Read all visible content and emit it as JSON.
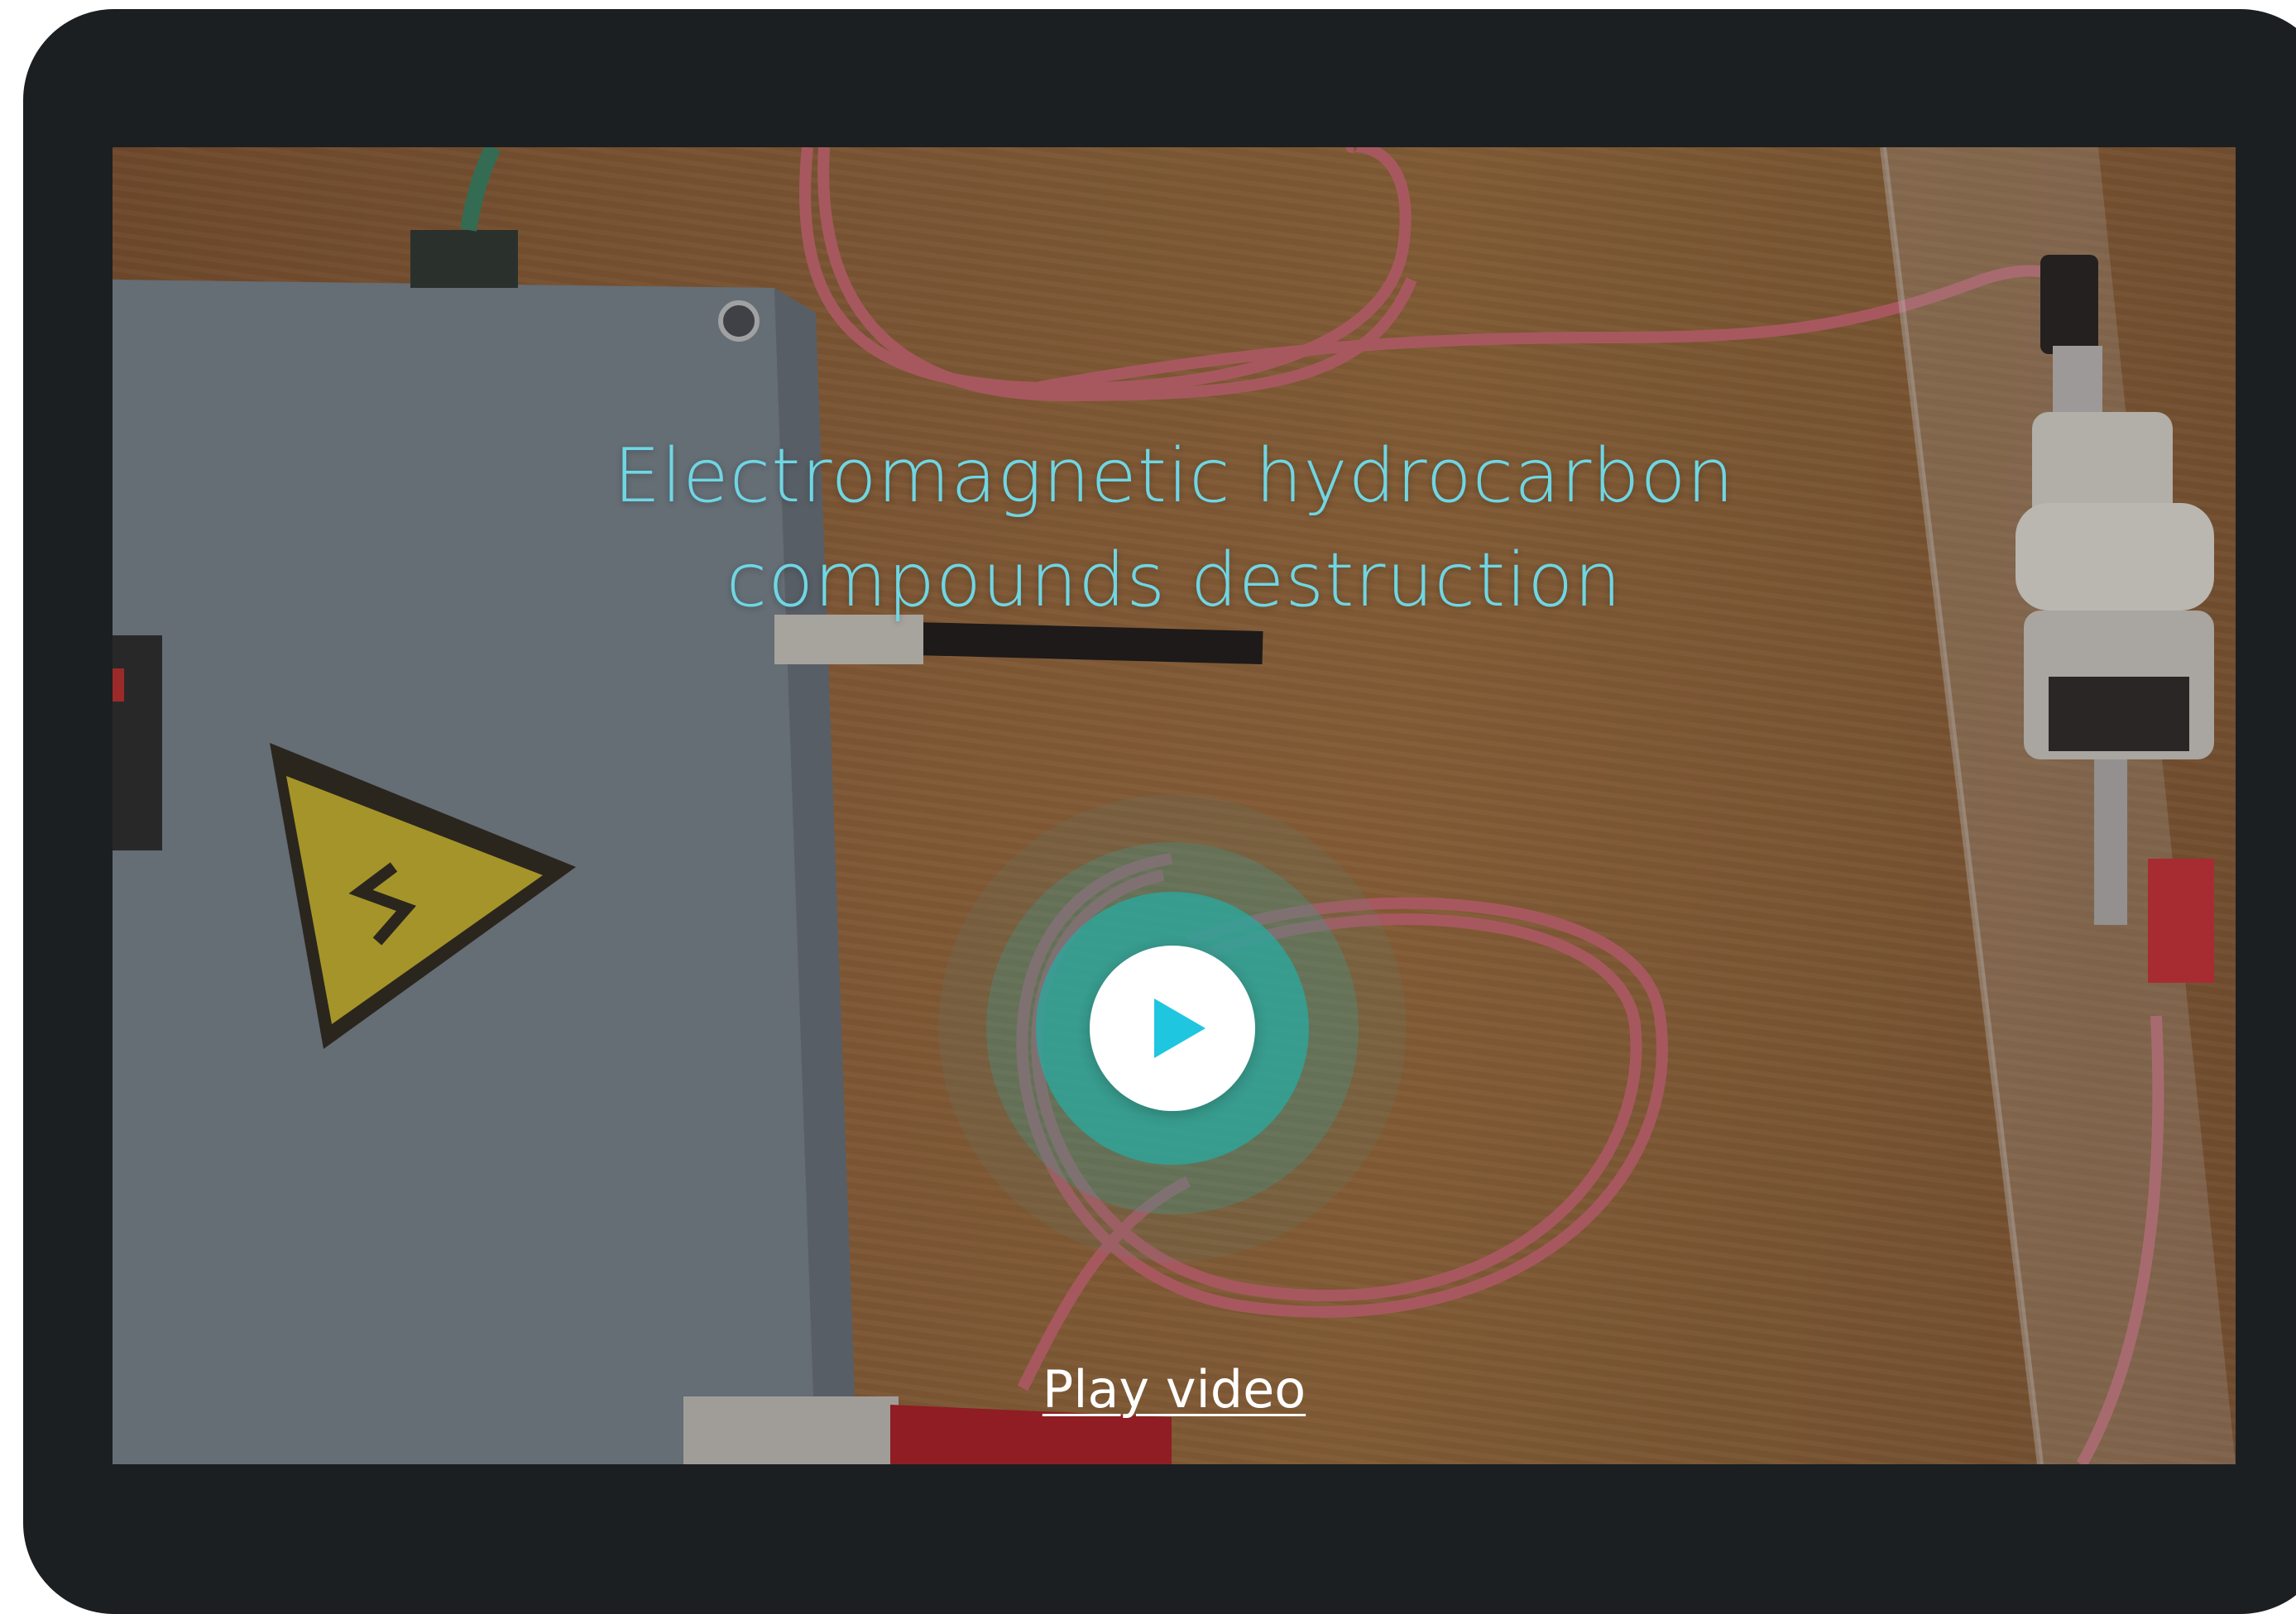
{
  "video": {
    "title_line1": "Electromagnetic hydrocarbon",
    "title_line2": "compounds destruction",
    "play_link_label": "Play video"
  },
  "icons": {
    "play": "play-icon",
    "warning": "high-voltage-warning-icon"
  },
  "colors": {
    "device_frame": "#1b1f22",
    "title": "#6fd6e3",
    "play_ring": "#28aaa0",
    "play_triangle": "#1ec6e0",
    "link": "#ffffff"
  }
}
